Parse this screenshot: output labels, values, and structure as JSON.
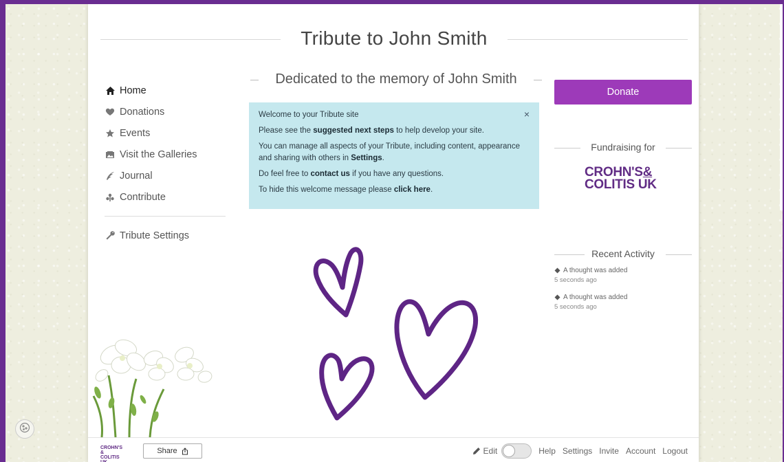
{
  "page": {
    "title": "Tribute to John Smith",
    "dedication": "Dedicated to the memory of John Smith"
  },
  "nav": {
    "items": [
      {
        "label": "Home",
        "icon": "home-icon"
      },
      {
        "label": "Donations",
        "icon": "heart-icon"
      },
      {
        "label": "Events",
        "icon": "star-icon"
      },
      {
        "label": "Visit the Galleries",
        "icon": "gallery-icon"
      },
      {
        "label": "Journal",
        "icon": "quill-icon"
      },
      {
        "label": "Contribute",
        "icon": "contribute-icon"
      }
    ],
    "settings_label": "Tribute Settings"
  },
  "welcome": {
    "line1": "Welcome to your Tribute site",
    "line2_pre": "Please see the ",
    "line2_bold": "suggested next steps",
    "line2_post": " to help develop your site.",
    "line3_pre": "You can manage all aspects of your Tribute, including content, appearance and sharing with others in ",
    "line3_bold": "Settings",
    "line3_post": ".",
    "line4_pre": "Do feel free to ",
    "line4_bold": "contact us",
    "line4_post": " if you have any questions.",
    "line5_pre": "To hide this welcome message please ",
    "line5_bold": "click here",
    "line5_post": ".",
    "close": "×"
  },
  "sidebar_right": {
    "donate_label": "Donate",
    "fundraising_label": "Fundraising for",
    "charity_line1": "CROHN'S",
    "charity_amp": "&",
    "charity_line2": "COLITIS UK",
    "recent_label": "Recent Activity",
    "activity": [
      {
        "text": "A thought was added",
        "time": "5 seconds ago"
      },
      {
        "text": "A thought was added",
        "time": "5 seconds ago"
      }
    ]
  },
  "footer": {
    "mini_logo_line1": "CROHN'S &",
    "mini_logo_line2": "COLITIS UK",
    "share_label": "Share",
    "edit_label": "Edit",
    "links": [
      "Help",
      "Settings",
      "Invite",
      "Account",
      "Logout"
    ]
  },
  "colors": {
    "accent": "#9d3ab9",
    "brand": "#612c85",
    "welcome_bg": "#c5e8ee",
    "border": "#6a2d91"
  }
}
